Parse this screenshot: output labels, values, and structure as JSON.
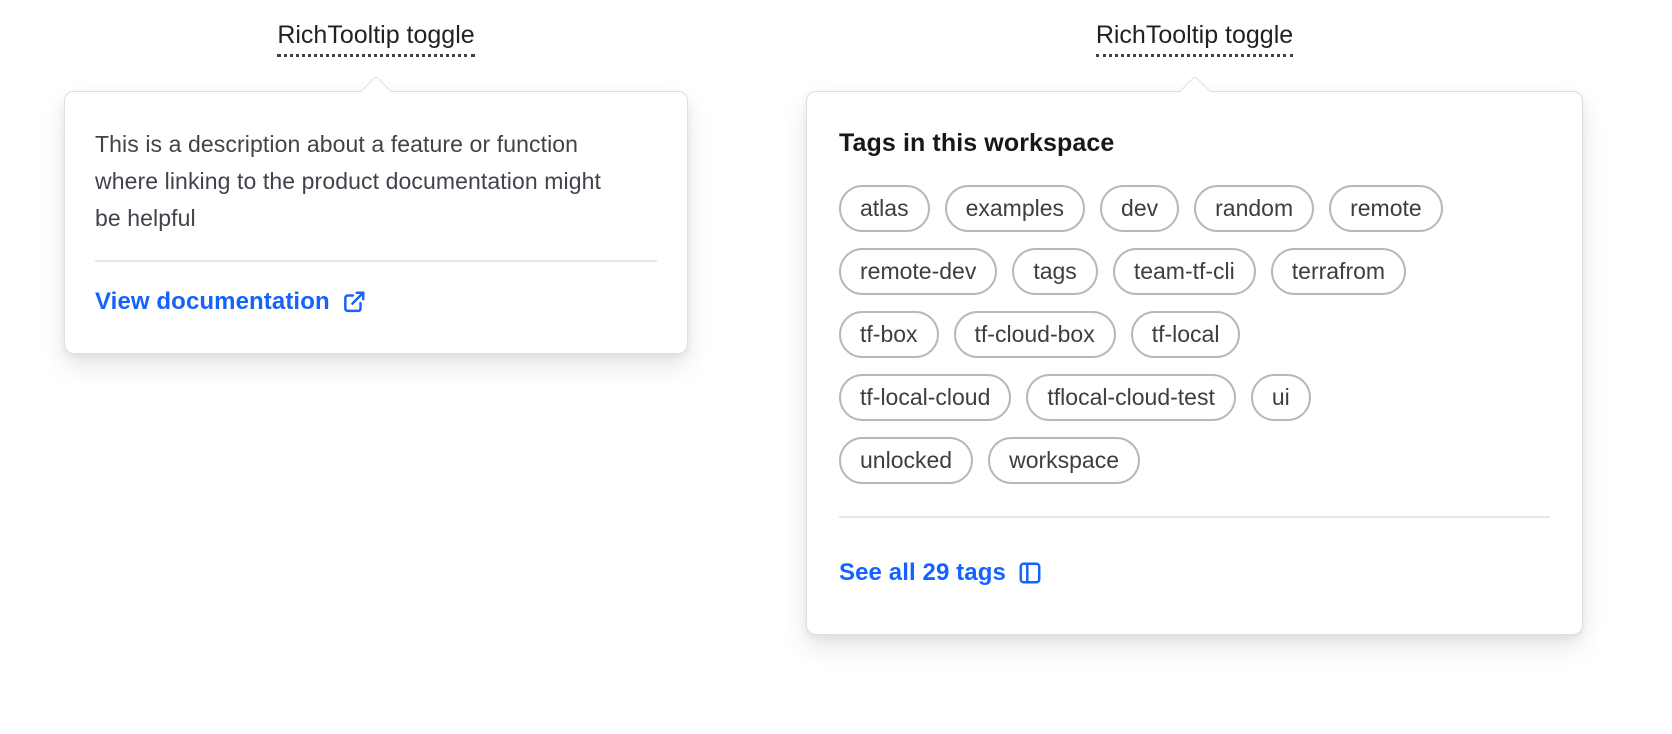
{
  "colors": {
    "accent": "#1563ff",
    "card_border": "#dcdee3",
    "divider": "#e4e6ea",
    "pill_border": "#b4b8bf"
  },
  "left_tooltip": {
    "toggle_label": "RichTooltip toggle",
    "description": "This is a description about a feature or function where linking to the product documentation might be helpful",
    "link": {
      "label": "View documentation",
      "icon": "external-link-icon"
    }
  },
  "right_tooltip": {
    "toggle_label": "RichTooltip toggle",
    "heading": "Tags in this workspace",
    "tag_rows": [
      [
        "atlas",
        "examples",
        "dev",
        "random",
        "remote"
      ],
      [
        "remote-dev",
        "tags",
        "team-tf-cli",
        "terrafrom"
      ],
      [
        "tf-box",
        "tf-cloud-box",
        "tf-local"
      ],
      [
        "tf-local-cloud",
        "tflocal-cloud-test",
        "ui"
      ],
      [
        "unlocked",
        "workspace"
      ]
    ],
    "link": {
      "label": "See all 29 tags",
      "icon": "sidebar-icon"
    }
  }
}
